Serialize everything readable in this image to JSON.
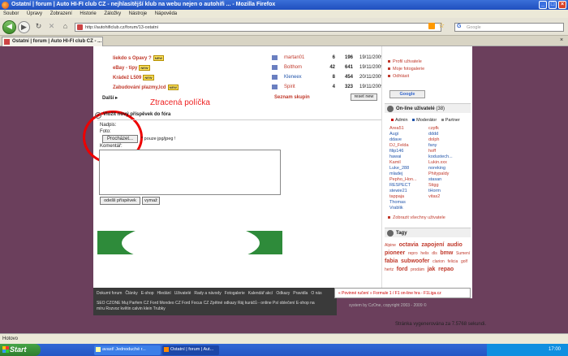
{
  "browser": {
    "title": "Ostatní | forum | Auto HI-FI club CZ - nejhlasitější klub na webu nejen o autohifi ... - Mozilla Firefox",
    "menu": [
      "Soubor",
      "Úpravy",
      "Zobrazení",
      "Historie",
      "Záložky",
      "Nástroje",
      "Nápověda"
    ],
    "url": "http://autohificlub.cz/forum/13-ostatni",
    "search_placeholder": "Google",
    "tab": "Ostatní | forum | Auto HI-FI club CZ - ...",
    "status": "Hotovo"
  },
  "topics": [
    {
      "title": "liekdo s Opavy ?",
      "user": "martan01",
      "replies": "6",
      "views": "196",
      "date": "19/11/2009 16:34",
      "user_style": "red"
    },
    {
      "title": "eBay - tipy",
      "user": "Bolthom",
      "replies": "42",
      "views": "641",
      "date": "19/11/2009 09:11",
      "user_style": "red"
    },
    {
      "title": "Krádež L509",
      "user": "Kleneex",
      "replies": "8",
      "views": "454",
      "date": "20/11/2009 14:56",
      "user_style": "blue"
    },
    {
      "title": "Zabudování plazmy,lcd",
      "user": "Spirit",
      "replies": "4",
      "views": "323",
      "date": "19/11/2009 18:58",
      "user_style": "red"
    }
  ],
  "new_badge": "NEW",
  "list_footer": {
    "more": "Další ▸",
    "members": "Seznam skupin",
    "reset": "reset new"
  },
  "annotation": "Ztracená políčka",
  "form": {
    "title": "Vložit nový příspěvek do fóra",
    "label_title": "Nadpis:",
    "label_photo": "Foto:",
    "browse": "Procházet...",
    "photo_note": "* pouze jpg/jpeg !",
    "label_comment": "Komentář:",
    "submit": "odešli příspěvek",
    "clear": "vymaž"
  },
  "sidebar": {
    "links": [
      "Profil uživatele",
      "Moje fotogalerie",
      "Odhlásit"
    ],
    "google": "Google",
    "online_title": "On-line uživatelé",
    "online_count": "(38)",
    "legend": [
      "Admin",
      "Moderátor",
      "Partner"
    ],
    "users_left": [
      "Area51",
      "Augi",
      "ddave",
      "DJ_Felda",
      "filip146",
      "hawai",
      "Kamil",
      "Luke_288",
      "mladej",
      "Pepho_Hon...",
      "RESPECT",
      "stewie21",
      "tappaja",
      "Thomas",
      "Vrablik"
    ],
    "users_right": [
      "czpfk",
      "dddd",
      "dolph",
      "fany",
      "hoff",
      "kodustech...",
      "Lukin.xxx",
      "noreking",
      "Phitypaldy",
      "stasan",
      "Stigg",
      "tHorm",
      "vitas2"
    ],
    "all_users": "Zobrazit všechny uživatele",
    "tags_title": "Tagy",
    "tags": [
      "Alpine",
      "octavia",
      "zapojení",
      "audio",
      "pioneer",
      "repro",
      "helix",
      "dls",
      "bmw",
      "Sumení",
      "fabia",
      "subwoofer",
      "clarion",
      "felicia",
      "golf",
      "hertz",
      "ford",
      "prodám",
      "jak",
      "repao"
    ]
  },
  "footer": {
    "links_row1": [
      "Dokumt forum",
      "Články",
      "E-shop",
      "Hledání",
      "Uživatelé",
      "Rady a návody",
      "Fotogalerie",
      "Kalendář akcí",
      "Odkazy",
      "Pravidla",
      "O nás"
    ],
    "row2": "SEO CZONE   Muj Parfem CZ   Ford Mondeo CZ   Ford Focus CZ   Zpětné odkazy   Ráj kuráčů - online Psí oblečení E-shop na",
    "row3": "míru Rozvoz květin                  calvin klein                                    Trubky",
    "sponsor": "« Povinné ručení » Formule 1 / F1 on-line hra - F1Liga.cz",
    "copyright": "system by CzOne, copyright 2003 - 2009 ©",
    "gen_time": "Stránka vygenerována za 7.5768 sekundi."
  },
  "taskbar": {
    "start": "Start",
    "items": [
      "avast! Jednoduché r...",
      "Ostatní | forum | Aut..."
    ],
    "clock": "17:00"
  }
}
